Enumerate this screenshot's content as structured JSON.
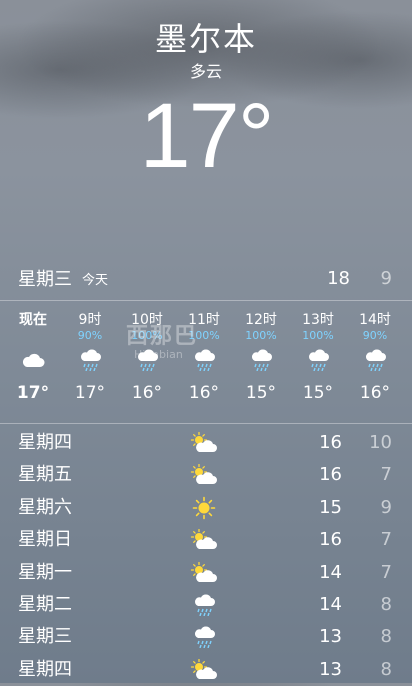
{
  "location": {
    "city": "墨尔本",
    "condition": "多云",
    "temperature": "17°"
  },
  "today": {
    "day": "星期三",
    "tag": "今天",
    "high": "18",
    "low": "9"
  },
  "hourly": [
    {
      "time": "现在",
      "prob": "",
      "icon": "cloud-icon",
      "temp": "17°"
    },
    {
      "time": "9时",
      "prob": "90%",
      "icon": "cloud-rain-icon",
      "temp": "17°"
    },
    {
      "time": "10时",
      "prob": "100%",
      "icon": "cloud-rain-icon",
      "temp": "16°"
    },
    {
      "time": "11时",
      "prob": "100%",
      "icon": "cloud-rain-icon",
      "temp": "16°"
    },
    {
      "time": "12时",
      "prob": "100%",
      "icon": "cloud-rain-icon",
      "temp": "15°"
    },
    {
      "time": "13时",
      "prob": "100%",
      "icon": "cloud-rain-icon",
      "temp": "15°"
    },
    {
      "time": "14时",
      "prob": "90%",
      "icon": "cloud-rain-icon",
      "temp": "16°"
    }
  ],
  "watermark": {
    "text": "西那巴",
    "sub": "Hinabian"
  },
  "daily": [
    {
      "day": "星期四",
      "icon": "partly-cloudy-icon",
      "high": "16",
      "low": "10"
    },
    {
      "day": "星期五",
      "icon": "partly-cloudy-icon",
      "high": "16",
      "low": "7"
    },
    {
      "day": "星期六",
      "icon": "sun-icon",
      "high": "15",
      "low": "9"
    },
    {
      "day": "星期日",
      "icon": "partly-cloudy-icon",
      "high": "16",
      "low": "7"
    },
    {
      "day": "星期一",
      "icon": "partly-cloudy-icon",
      "high": "14",
      "low": "7"
    },
    {
      "day": "星期二",
      "icon": "cloud-rain-icon",
      "high": "14",
      "low": "8"
    },
    {
      "day": "星期三",
      "icon": "cloud-rain-icon",
      "high": "13",
      "low": "8"
    },
    {
      "day": "星期四",
      "icon": "partly-cloudy-icon",
      "high": "13",
      "low": "8"
    }
  ],
  "colors": {
    "precip": "#7fd3ff",
    "sun": "#ffd93b",
    "dim_text": "rgba(255,255,255,0.6)"
  }
}
